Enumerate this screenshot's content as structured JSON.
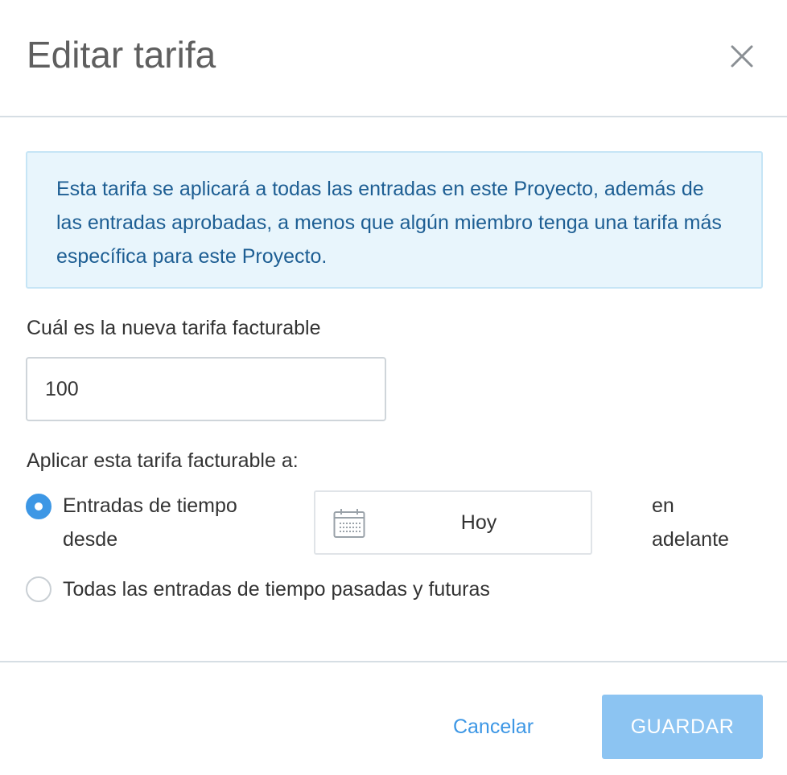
{
  "dialog": {
    "title": "Editar tarifa",
    "close_icon": "close-icon"
  },
  "info": {
    "text": "Esta tarifa se aplicará a todas las entradas en este Proyecto, además de las entradas aprobadas, a menos que algún miembro tenga una tarifa más específica para este Proyecto."
  },
  "rate": {
    "label": "Cuál es la nueva tarifa facturable",
    "value": "100"
  },
  "apply": {
    "label": "Aplicar esta tarifa facturable a:",
    "options": [
      {
        "label_line1": "Entradas de tiempo",
        "label_line2": "desde",
        "selected": true
      },
      {
        "label": "Todas las entradas de tiempo pasadas y futuras",
        "selected": false
      }
    ],
    "date_icon": "calendar-icon",
    "date_value": "Hoy",
    "suffix_line1": "en",
    "suffix_line2": "adelante"
  },
  "footer": {
    "cancel_label": "Cancelar",
    "save_label": "GUARDAR"
  },
  "colors": {
    "accent": "#3d97e5",
    "save_disabled": "#8cc4f2",
    "info_bg": "#e8f5fc",
    "info_text": "#1d5e93"
  }
}
